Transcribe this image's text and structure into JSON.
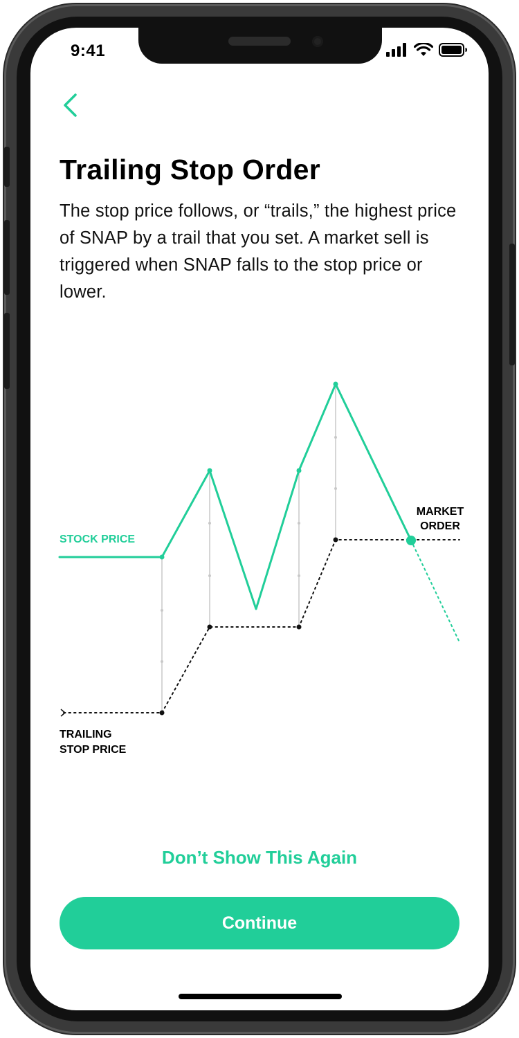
{
  "status_bar": {
    "time": "9:41"
  },
  "header": {
    "back_icon": "chevron-left-icon"
  },
  "content": {
    "title": "Trailing Stop Order",
    "description": "The stop price follows, or “trails,” the highest price of SNAP by a trail that you set. A market sell is triggered when SNAP falls to the stop price or lower."
  },
  "diagram": {
    "stock_price_label": "STOCK PRICE",
    "trailing_stop_label_line1": "TRAILING",
    "trailing_stop_label_line2": "STOP PRICE",
    "market_order_label_line1": "MARKET",
    "market_order_label_line2": "ORDER"
  },
  "actions": {
    "dont_show_label": "Don’t Show This Again",
    "continue_label": "Continue"
  },
  "colors": {
    "accent": "#21ce99",
    "text": "#000000"
  }
}
